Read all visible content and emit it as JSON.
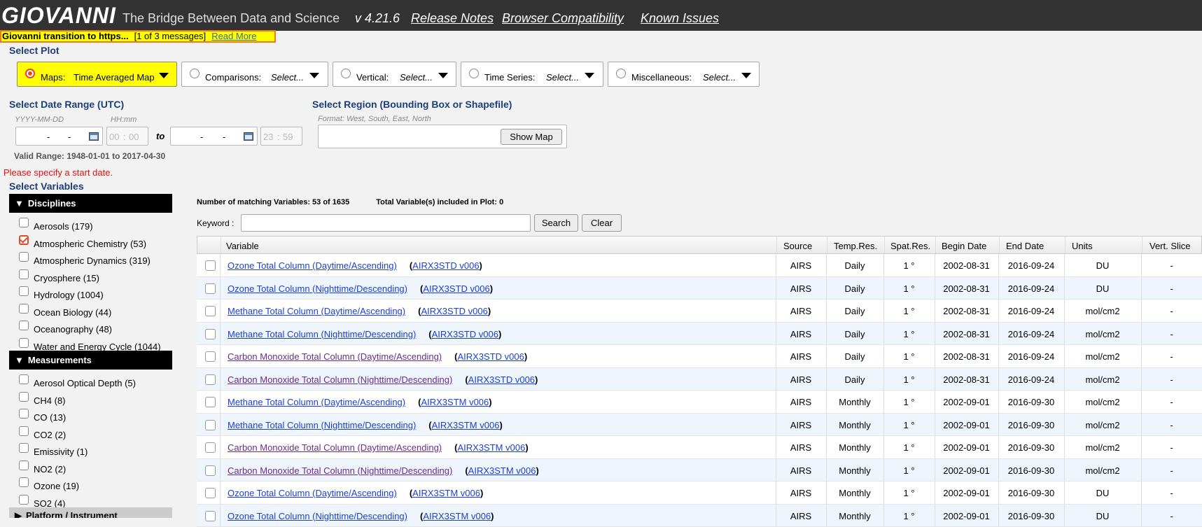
{
  "header": {
    "logo": "GIOVANNI",
    "tagline": "The Bridge Between Data and Science",
    "version": "v 4.21.6",
    "links": [
      "Release Notes",
      "Browser Compatibility",
      "Known Issues"
    ]
  },
  "banner": {
    "title": "Giovanni transition to https...",
    "count": "[1 of 3 messages]",
    "read_more": "Read More"
  },
  "plot": {
    "title": "Select Plot",
    "options": [
      {
        "label": "Maps:",
        "value": "Time Averaged Map"
      },
      {
        "label": "Comparisons:",
        "value": "Select..."
      },
      {
        "label": "Vertical:",
        "value": "Select..."
      },
      {
        "label": "Time Series:",
        "value": "Select..."
      },
      {
        "label": "Miscellaneous:",
        "value": "Select..."
      }
    ]
  },
  "date": {
    "title": "Select Date Range (UTC)",
    "date_hint": "YYYY-MM-DD",
    "time_hint": "HH:mm",
    "to": "to",
    "start_time": {
      "h": "00",
      "m": "00"
    },
    "end_time": {
      "h": "23",
      "m": "59"
    },
    "valid_range": "Valid Range: 1948-01-01 to 2017-04-30",
    "error": "Please specify a start date."
  },
  "region": {
    "title": "Select Region (Bounding Box or Shapefile)",
    "format": "Format: West, South, East, North",
    "show_map": "Show Map"
  },
  "variables": {
    "title": "Select Variables",
    "disciplines_title": "Disciplines",
    "disciplines": [
      {
        "label": "Aerosols (179)",
        "checked": false
      },
      {
        "label": "Atmospheric Chemistry (53)",
        "checked": true
      },
      {
        "label": "Atmospheric Dynamics (319)",
        "checked": false
      },
      {
        "label": "Cryosphere (15)",
        "checked": false
      },
      {
        "label": "Hydrology (1004)",
        "checked": false
      },
      {
        "label": "Ocean Biology (44)",
        "checked": false
      },
      {
        "label": "Oceanography (48)",
        "checked": false
      },
      {
        "label": "Water and Energy Cycle (1044)",
        "checked": false
      }
    ],
    "measurements_title": "Measurements",
    "measurements": [
      {
        "label": "Aerosol Optical Depth (5)",
        "checked": false
      },
      {
        "label": "CH4 (8)",
        "checked": false
      },
      {
        "label": "CO (13)",
        "checked": false
      },
      {
        "label": "CO2 (2)",
        "checked": false
      },
      {
        "label": "Emissivity (1)",
        "checked": false
      },
      {
        "label": "NO2 (2)",
        "checked": false
      },
      {
        "label": "Ozone (19)",
        "checked": false
      },
      {
        "label": "SO2 (4)",
        "checked": false
      }
    ],
    "platform_title": "Platform / Instrument",
    "matching": "Number of matching Variables: 53 of 1635",
    "total": "Total Variable(s) included in Plot: 0",
    "keyword_label": "Keyword :",
    "search": "Search",
    "clear": "Clear"
  },
  "table": {
    "headers": [
      "Variable",
      "Source",
      "Temp.Res.",
      "Spat.Res.",
      "Begin Date",
      "End Date",
      "Units",
      "Vert. Slice"
    ],
    "rows": [
      {
        "name": "Ozone Total Column (Daytime/Ascending)",
        "product": "AIRX3STD v006",
        "source": "AIRS",
        "temp": "Daily",
        "spat": "1 °",
        "begin": "2002-08-31",
        "end": "2016-09-24",
        "units": "DU",
        "vert": "-",
        "visited": false
      },
      {
        "name": "Ozone Total Column (Nighttime/Descending)",
        "product": "AIRX3STD v006",
        "source": "AIRS",
        "temp": "Daily",
        "spat": "1 °",
        "begin": "2002-08-31",
        "end": "2016-09-24",
        "units": "DU",
        "vert": "-",
        "visited": false
      },
      {
        "name": "Methane Total Column (Daytime/Ascending)",
        "product": "AIRX3STD v006",
        "source": "AIRS",
        "temp": "Daily",
        "spat": "1 °",
        "begin": "2002-08-31",
        "end": "2016-09-24",
        "units": "mol/cm2",
        "vert": "-",
        "visited": false
      },
      {
        "name": "Methane Total Column (Nighttime/Descending)",
        "product": "AIRX3STD v006",
        "source": "AIRS",
        "temp": "Daily",
        "spat": "1 °",
        "begin": "2002-08-31",
        "end": "2016-09-24",
        "units": "mol/cm2",
        "vert": "-",
        "visited": false
      },
      {
        "name": "Carbon Monoxide Total Column (Daytime/Ascending)",
        "product": "AIRX3STD v006",
        "source": "AIRS",
        "temp": "Daily",
        "spat": "1 °",
        "begin": "2002-08-31",
        "end": "2016-09-24",
        "units": "mol/cm2",
        "vert": "-",
        "visited": true
      },
      {
        "name": "Carbon Monoxide Total Column (Nighttime/Descending)",
        "product": "AIRX3STD v006",
        "source": "AIRS",
        "temp": "Daily",
        "spat": "1 °",
        "begin": "2002-08-31",
        "end": "2016-09-24",
        "units": "mol/cm2",
        "vert": "-",
        "visited": true
      },
      {
        "name": "Methane Total Column (Daytime/Ascending)",
        "product": "AIRX3STM v006",
        "source": "AIRS",
        "temp": "Monthly",
        "spat": "1 °",
        "begin": "2002-09-01",
        "end": "2016-09-30",
        "units": "mol/cm2",
        "vert": "-",
        "visited": false
      },
      {
        "name": "Methane Total Column (Nighttime/Descending)",
        "product": "AIRX3STM v006",
        "source": "AIRS",
        "temp": "Monthly",
        "spat": "1 °",
        "begin": "2002-09-01",
        "end": "2016-09-30",
        "units": "mol/cm2",
        "vert": "-",
        "visited": false
      },
      {
        "name": "Carbon Monoxide Total Column (Daytime/Ascending)",
        "product": "AIRX3STM v006",
        "source": "AIRS",
        "temp": "Monthly",
        "spat": "1 °",
        "begin": "2002-09-01",
        "end": "2016-09-30",
        "units": "mol/cm2",
        "vert": "-",
        "visited": true
      },
      {
        "name": "Carbon Monoxide Total Column (Nighttime/Descending)",
        "product": "AIRX3STM v006",
        "source": "AIRS",
        "temp": "Monthly",
        "spat": "1 °",
        "begin": "2002-09-01",
        "end": "2016-09-30",
        "units": "mol/cm2",
        "vert": "-",
        "visited": true
      },
      {
        "name": "Ozone Total Column (Daytime/Ascending)",
        "product": "AIRX3STM v006",
        "source": "AIRS",
        "temp": "Monthly",
        "spat": "1 °",
        "begin": "2002-09-01",
        "end": "2016-09-30",
        "units": "DU",
        "vert": "-",
        "visited": false
      },
      {
        "name": "Ozone Total Column (Nighttime/Descending)",
        "product": "AIRX3STM v006",
        "source": "AIRS",
        "temp": "Monthly",
        "spat": "1 °",
        "begin": "2002-09-01",
        "end": "2016-09-30",
        "units": "DU",
        "vert": "-",
        "visited": false
      }
    ]
  }
}
